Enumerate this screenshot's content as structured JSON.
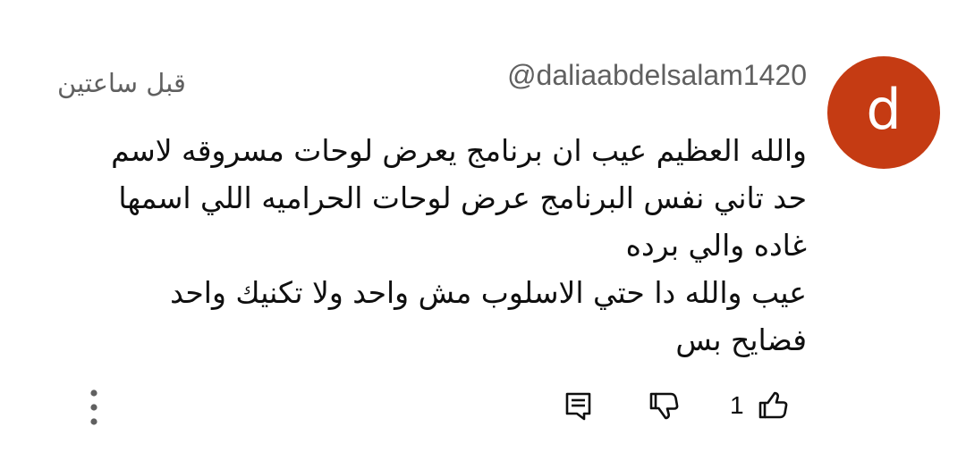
{
  "comment": {
    "avatar_letter": "d",
    "avatar_color": "#c53b13",
    "author": "@daliaabdelsalam1420",
    "time": "قبل ساعتين",
    "lines": [
      "والله العظيم عيب ان برنامج يعرض لوحات مسروقه لاسم",
      "حد تاني نفس البرنامج عرض لوحات الحراميه اللي اسمها",
      "غاده والي برده",
      "عيب والله دا حتي الاسلوب مش واحد ولا تكنيك واحد",
      "فضايح بس"
    ]
  },
  "actions": {
    "like_count": "1",
    "icons": [
      "thumbs-up-icon",
      "thumbs-down-icon",
      "reply-comment-icon",
      "more-vertical-icon"
    ]
  }
}
